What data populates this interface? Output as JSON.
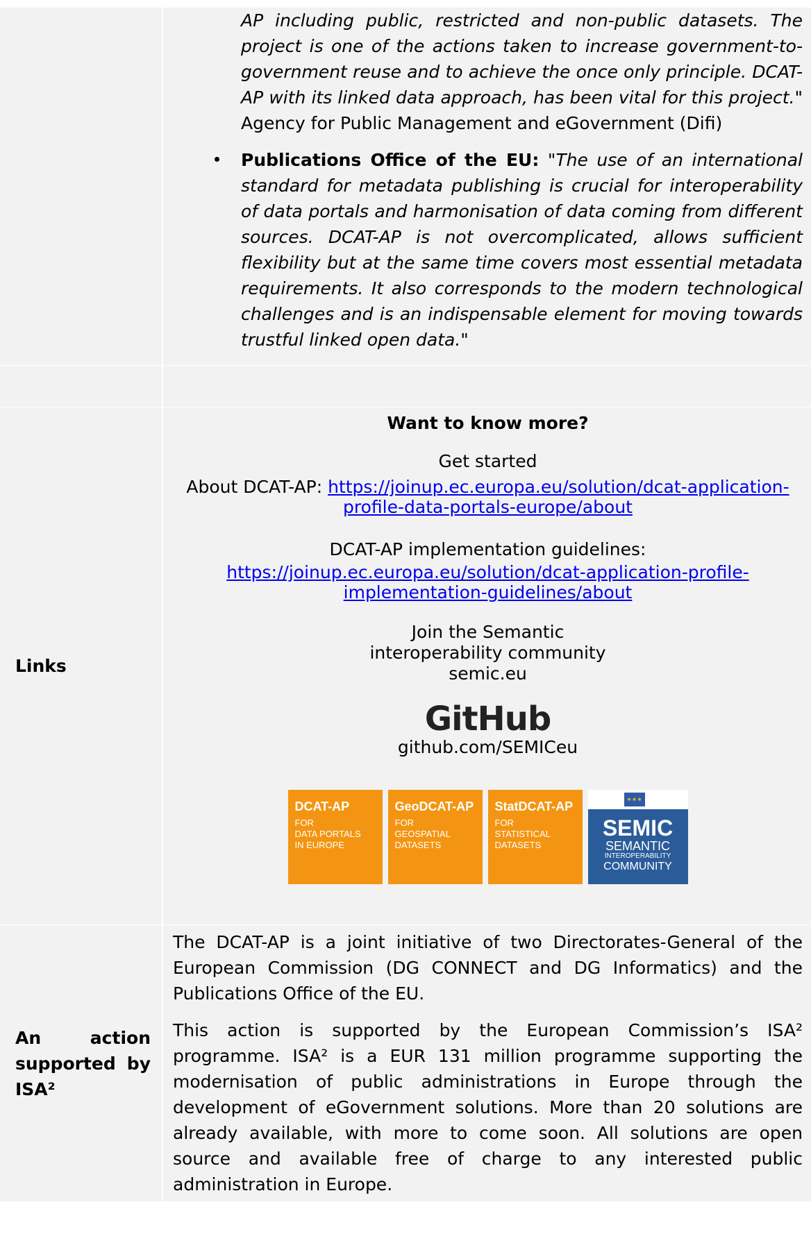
{
  "quotes": {
    "continuation": "AP including public, restricted and non-public datasets. The project is one of the actions taken to increase government-to-government reuse and to achieve the once only principle. DCAT-AP with its linked data approach, has been vital for this project.\"",
    "continuation_source": " Agency for Public Management and eGovernment (Difi)",
    "items": [
      {
        "org": "Publications Office of the EU:",
        "text": " \"The use of an international standard for metadata publishing is crucial for interoperability of data portals and harmonisation of data coming from different sources. DCAT-AP is not overcomplicated, allows sufficient flexibility but at the same time covers most essential metadata requirements. It also corresponds to the modern technological challenges and is an indispensable element for moving towards trustful linked open data.\""
      }
    ]
  },
  "links": {
    "label": "Links",
    "heading": "Want to know more?",
    "get_started": "Get started",
    "about_prefix": "About DCAT-AP: ",
    "about_url": "https://joinup.ec.europa.eu/solution/dcat-application-profile-data-portals-europe/about",
    "guidelines_label": "DCAT-AP implementation guidelines:",
    "guidelines_url": "https://joinup.ec.europa.eu/solution/dcat-application-profile-implementation-guidelines/about",
    "join_line1": "Join the Semantic",
    "join_line2": "interoperability community",
    "join_line3": "semic.eu",
    "github_logo": "GitHub",
    "github_url": "github.com/SEMICeu",
    "tiles": [
      {
        "title": "DCAT-AP",
        "sub1": "FOR",
        "sub2": "DATA PORTALS",
        "sub3": "IN EUROPE"
      },
      {
        "title": "GeoDCAT-AP",
        "sub1": "FOR",
        "sub2": "GEOSPATIAL",
        "sub3": "DATASETS"
      },
      {
        "title": "StatDCAT-AP",
        "sub1": "FOR",
        "sub2": "STATISTICAL",
        "sub3": "DATASETS"
      }
    ],
    "semic": {
      "name": "SEMIC",
      "l1": "SEMANTIC",
      "l2": "INTEROPERABILITY",
      "l3": "COMMUNITY"
    }
  },
  "isa": {
    "label": "An action supported by ISA²",
    "para1": "The DCAT-AP is a joint initiative of two Directorates-General of the European Commission (DG CONNECT and DG Informatics) and the Publications Office of the EU.",
    "para2": "This action is supported by the European Commission’s ISA² programme. ISA² is a EUR 131 million programme supporting the modernisation of public administrations in Europe through the development of eGovernment solutions. More than 20 solutions are already available, with more to come soon. All solutions are open source and available free of charge to any interested public administration in Europe."
  },
  "colors": {
    "cell_bg": "#f2f2f2",
    "link": "#0000ee",
    "tile_orange": "#f39512",
    "semic_blue": "#2a5c9a"
  }
}
